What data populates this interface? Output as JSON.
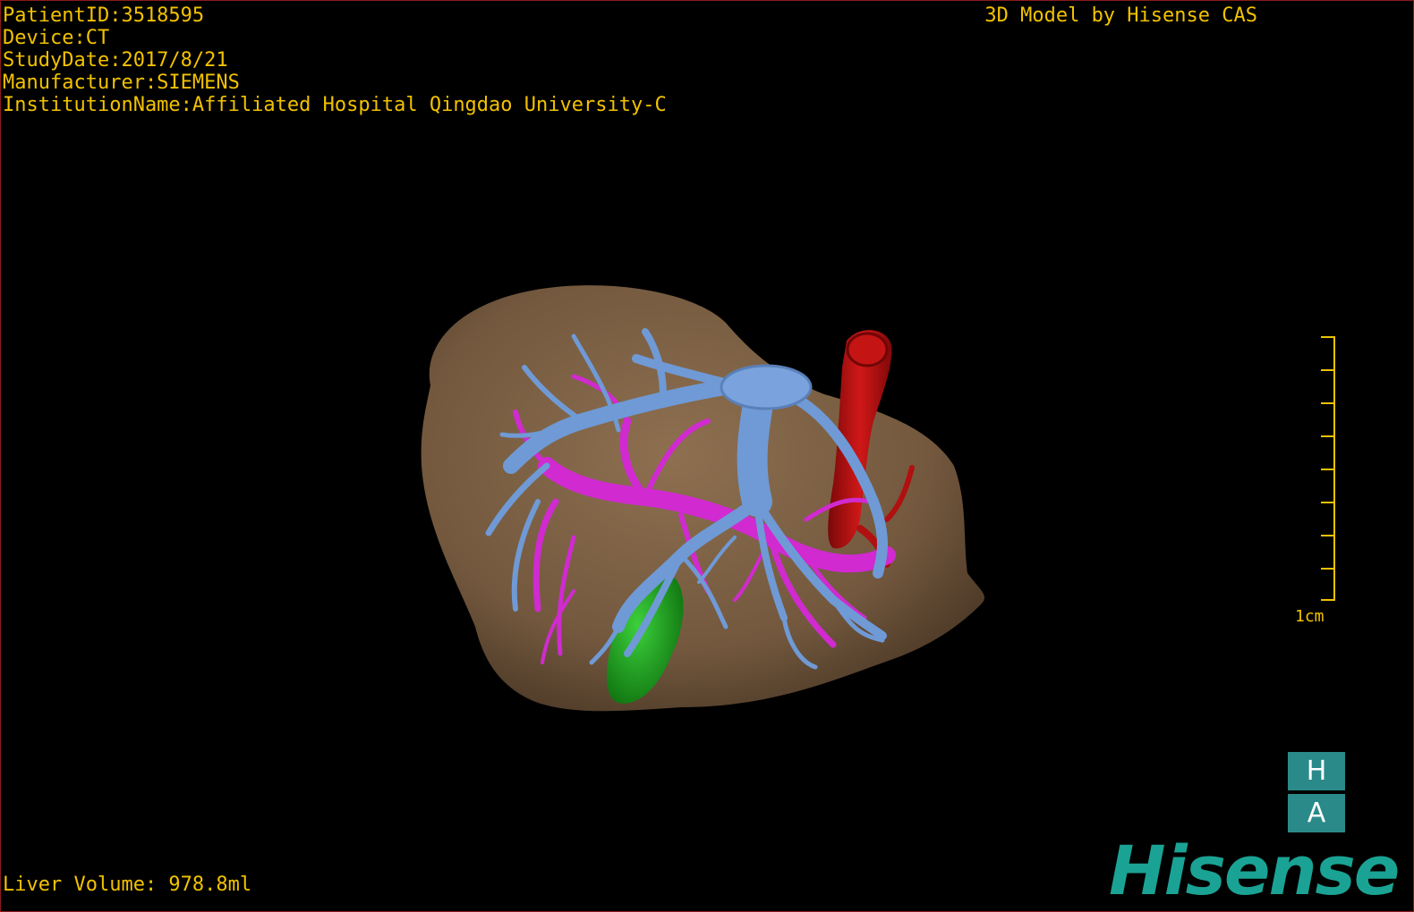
{
  "study_info": {
    "patient_id": "PatientID:3518595",
    "device": "Device:CT",
    "study_date": "StudyDate:2017/8/21",
    "manufacturer": "Manufacturer:SIEMENS",
    "institution": "InstitutionName:Affiliated Hospital Qingdao University-C"
  },
  "brand_line": "3D Model by Hisense CAS",
  "liver_volume": "Liver Volume: 978.8ml",
  "scale": {
    "label": "1cm"
  },
  "orientation": {
    "top_face": "H",
    "bottom_face": "A"
  },
  "logo": {
    "text": "Hisense"
  },
  "colors": {
    "overlay_text": "#f2c200",
    "liver": "#7a5f44",
    "hepatic_vein": "#6f9ad6",
    "portal_vein": "#d02ad0",
    "ivc_artery": "#b01010",
    "gallbladder": "#1aa01a",
    "logo": "#1aa394"
  }
}
